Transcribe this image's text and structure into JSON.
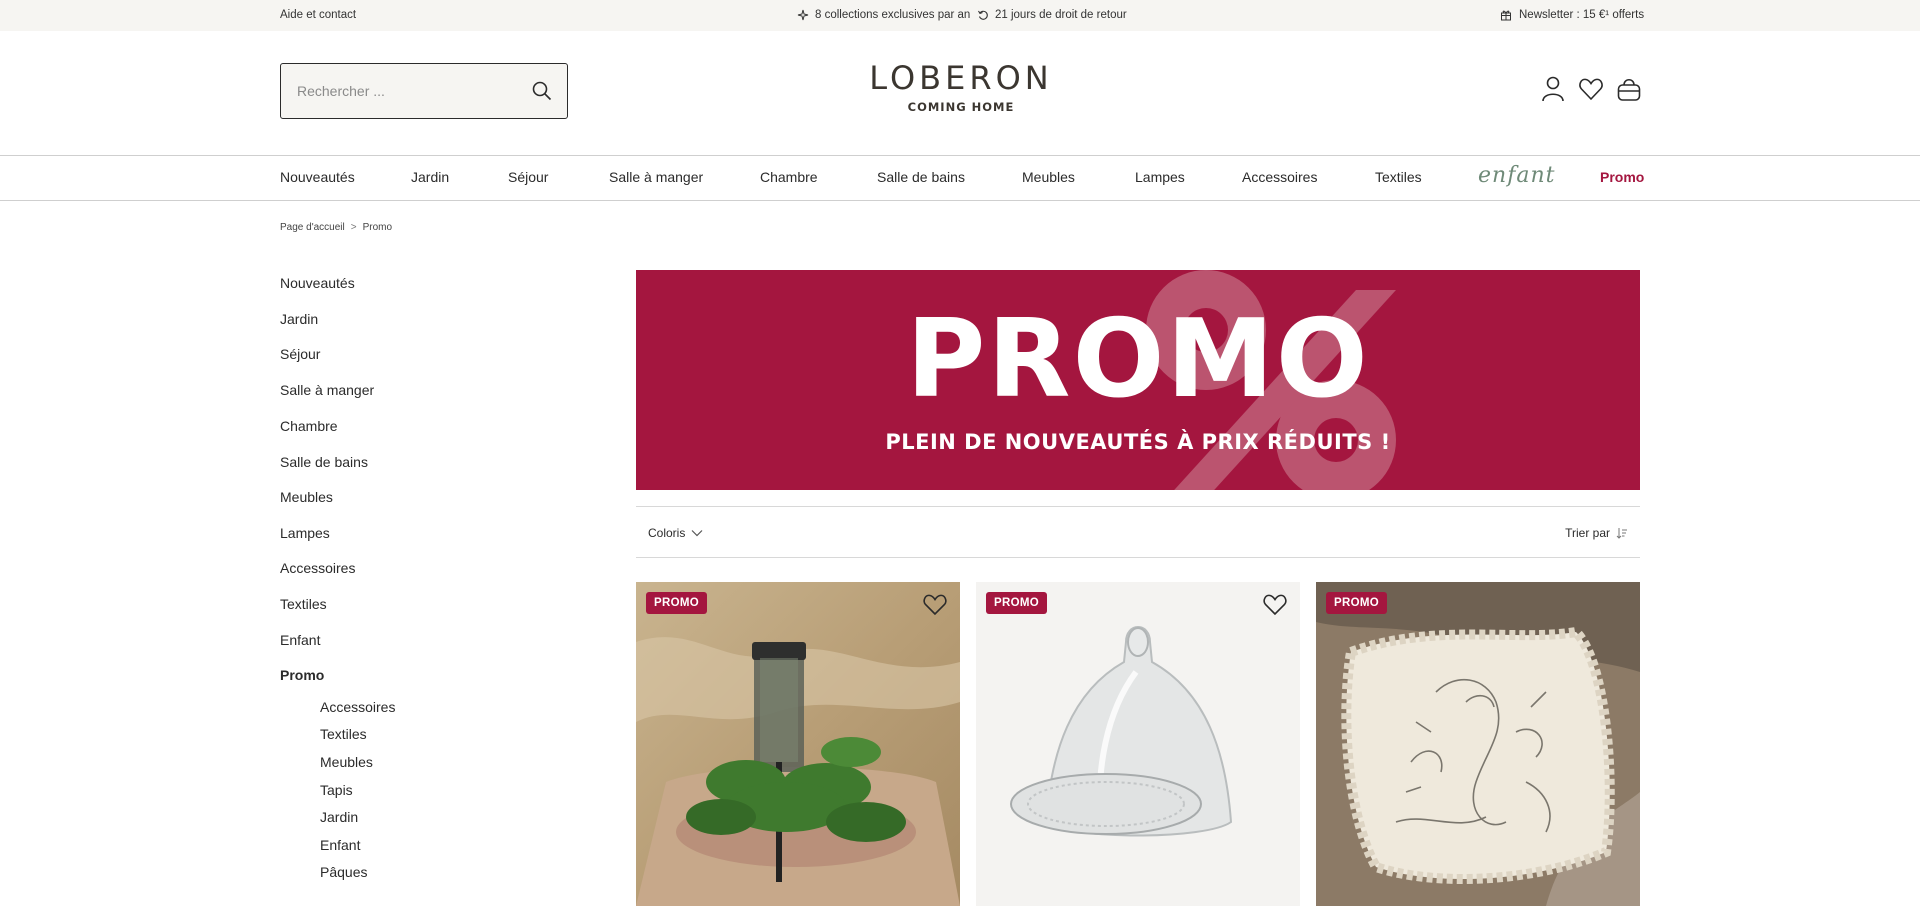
{
  "topbar": {
    "help": "Aide et contact",
    "usp1": "8 collections exclusives par an",
    "usp2": "21 jours de droit de retour",
    "newsletter": "Newsletter : 15 €¹ offerts",
    "icons": [
      "sparkle-icon",
      "return-icon",
      "gift-icon"
    ]
  },
  "header": {
    "search_placeholder": "Rechercher ...",
    "logo_brand": "LOBERON",
    "logo_tagline": "COMING HOME",
    "icons": [
      "account-icon",
      "wishlist-icon",
      "cart-icon"
    ]
  },
  "nav": {
    "items": [
      "Nouveautés",
      "Jardin",
      "Séjour",
      "Salle à manger",
      "Chambre",
      "Salle de bains",
      "Meubles",
      "Lampes",
      "Accessoires",
      "Textiles",
      "enfant",
      "Promo"
    ]
  },
  "breadcrumb": {
    "home": "Page d'accueil",
    "separator": ">",
    "current": "Promo"
  },
  "sidebar": {
    "categories": [
      "Nouveautés",
      "Jardin",
      "Séjour",
      "Salle à manger",
      "Chambre",
      "Salle de bains",
      "Meubles",
      "Lampes",
      "Accessoires",
      "Textiles",
      "Enfant",
      "Promo"
    ],
    "active": "Promo",
    "subcategories": [
      "Accessoires",
      "Textiles",
      "Meubles",
      "Tapis",
      "Jardin",
      "Enfant",
      "Pâques"
    ]
  },
  "banner": {
    "title": "PROMO",
    "subtitle": "PLEIN DE NOUVEAUTÉS À PRIX RÉDUITS !",
    "bg_color": "#a4163f"
  },
  "filters": {
    "colors_label": "Coloris",
    "sort_label": "Trier par"
  },
  "products": [
    {
      "badge": "PROMO",
      "wishlist": true,
      "image": "solar-lantern-photo"
    },
    {
      "badge": "PROMO",
      "wishlist": true,
      "image": "glass-cloche-photo"
    },
    {
      "badge": "PROMO",
      "wishlist": false,
      "image": "embroidered-cushion-photo"
    }
  ],
  "colors": {
    "accent": "#a4163f",
    "topbar_bg": "#f6f5f2",
    "text": "#2b2b2b"
  }
}
